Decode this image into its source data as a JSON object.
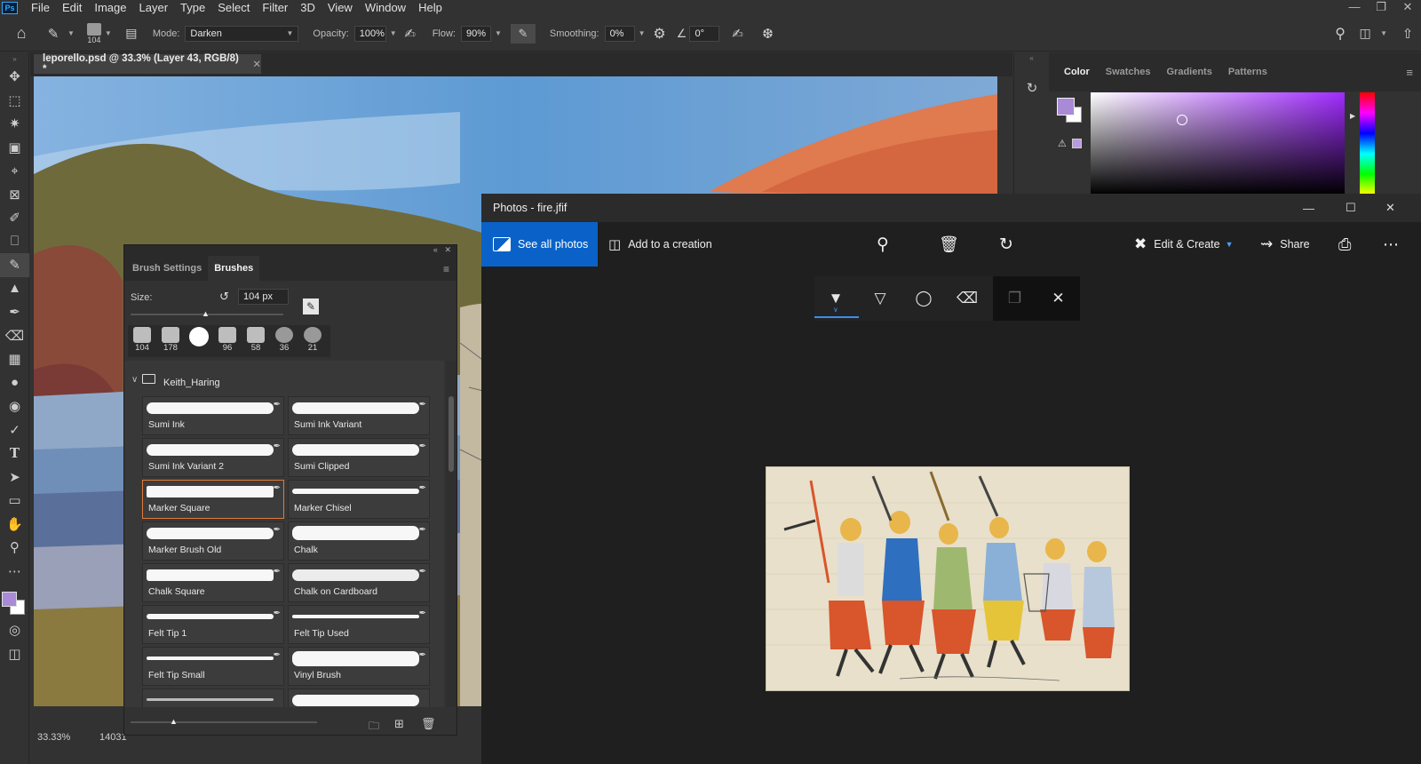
{
  "menubar": {
    "logo": "Ps",
    "items": [
      "File",
      "Edit",
      "Image",
      "Layer",
      "Type",
      "Select",
      "Filter",
      "3D",
      "View",
      "Window",
      "Help"
    ]
  },
  "options": {
    "brush_size": "104",
    "mode_label": "Mode:",
    "mode_value": "Darken",
    "opacity_label": "Opacity:",
    "opacity_value": "100%",
    "flow_label": "Flow:",
    "flow_value": "90%",
    "smoothing_label": "Smoothing:",
    "smoothing_value": "0%",
    "angle_value": "0°"
  },
  "document": {
    "tab_title": "leporello.psd @ 33.3% (Layer 43, RGB/8) *",
    "zoom": "33.33%",
    "status_info": "14031"
  },
  "color_panel": {
    "tabs": [
      "Color",
      "Swatches",
      "Gradients",
      "Patterns"
    ],
    "foreground_color": "#a98ad6"
  },
  "brushes_panel": {
    "tabs": [
      "Brush Settings",
      "Brushes"
    ],
    "size_label": "Size:",
    "size_value": "104 px",
    "presets": [
      "104",
      "178",
      "",
      "96",
      "58",
      "36",
      "21"
    ],
    "folder_name": "Keith_Haring",
    "brushes": [
      "Sumi Ink",
      "Sumi Ink Variant",
      "Sumi Ink Variant 2",
      "Sumi Clipped",
      "Marker Square",
      "Marker Chisel",
      "Marker Brush Old",
      "Chalk",
      "Chalk Square",
      "Chalk on Cardboard",
      "Felt Tip 1",
      "Felt Tip Used",
      "Felt Tip Small",
      "Vinyl Brush"
    ],
    "selected_brush": "Marker Square"
  },
  "photos": {
    "title": "Photos - fire.jfif",
    "see_all": "See all photos",
    "add_creation": "Add to a creation",
    "edit_create": "Edit & Create",
    "share": "Share",
    "accent": "#0a62c8"
  }
}
